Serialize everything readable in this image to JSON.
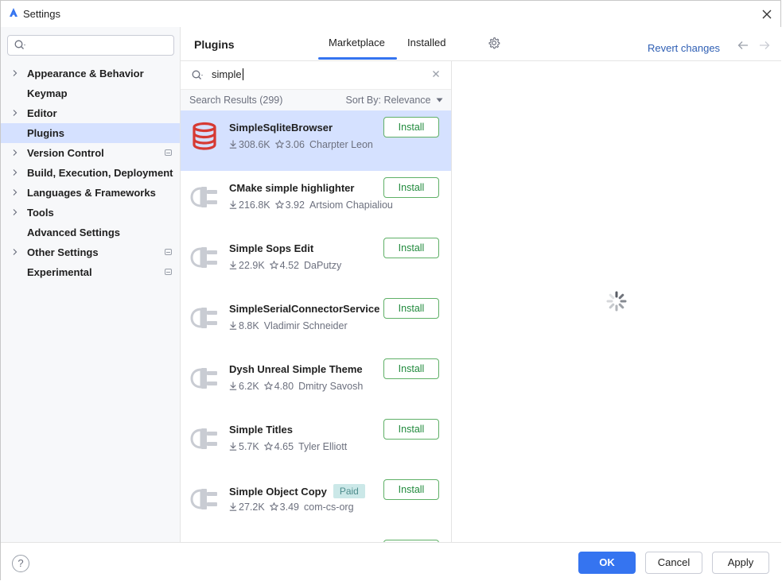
{
  "window": {
    "title": "Settings"
  },
  "sidebar": {
    "search_placeholder": "",
    "items": [
      {
        "label": "Appearance & Behavior",
        "expandable": true,
        "selected": false,
        "config": false
      },
      {
        "label": "Keymap",
        "expandable": false,
        "selected": false,
        "config": false
      },
      {
        "label": "Editor",
        "expandable": true,
        "selected": false,
        "config": false
      },
      {
        "label": "Plugins",
        "expandable": false,
        "selected": true,
        "config": false
      },
      {
        "label": "Version Control",
        "expandable": true,
        "selected": false,
        "config": true
      },
      {
        "label": "Build, Execution, Deployment",
        "expandable": true,
        "selected": false,
        "config": false
      },
      {
        "label": "Languages & Frameworks",
        "expandable": true,
        "selected": false,
        "config": false
      },
      {
        "label": "Tools",
        "expandable": true,
        "selected": false,
        "config": false
      },
      {
        "label": "Advanced Settings",
        "expandable": false,
        "selected": false,
        "config": false
      },
      {
        "label": "Other Settings",
        "expandable": true,
        "selected": false,
        "config": true
      },
      {
        "label": "Experimental",
        "expandable": false,
        "selected": false,
        "config": true
      }
    ]
  },
  "header": {
    "title": "Plugins",
    "tabs": [
      {
        "label": "Marketplace",
        "active": true
      },
      {
        "label": "Installed",
        "active": false
      }
    ],
    "revert_label": "Revert changes"
  },
  "search": {
    "value": "simple"
  },
  "results": {
    "count_label": "Search Results (299)",
    "sort_label": "Sort By: Relevance"
  },
  "plugins": [
    {
      "name": "SimpleSqliteBrowser",
      "downloads": "308.6K",
      "rating": "3.06",
      "vendor": "Charpter Leon",
      "button": "Install",
      "icon": "database-icon",
      "selected": true,
      "paid": false
    },
    {
      "name": "CMake simple highlighter",
      "downloads": "216.8K",
      "rating": "3.92",
      "vendor": "Artsiom Chapialiou",
      "button": "Install",
      "icon": "plugin-plug-icon",
      "selected": false,
      "paid": false
    },
    {
      "name": "Simple Sops Edit",
      "downloads": "22.9K",
      "rating": "4.52",
      "vendor": "DaPutzy",
      "button": "Install",
      "icon": "plugin-plug-icon",
      "selected": false,
      "paid": false
    },
    {
      "name": "SimpleSerialConnectorService",
      "downloads": "8.8K",
      "rating": "",
      "vendor": "Vladimir Schneider",
      "button": "Install",
      "icon": "plugin-plug-icon",
      "selected": false,
      "paid": false
    },
    {
      "name": "Dysh Unreal Simple Theme",
      "downloads": "6.2K",
      "rating": "4.80",
      "vendor": "Dmitry Savosh",
      "button": "Install",
      "icon": "plugin-plug-icon",
      "selected": false,
      "paid": false
    },
    {
      "name": "Simple Titles",
      "downloads": "5.7K",
      "rating": "4.65",
      "vendor": "Tyler Elliott",
      "button": "Install",
      "icon": "plugin-plug-icon",
      "selected": false,
      "paid": false
    },
    {
      "name": "Simple Object Copy",
      "downloads": "27.2K",
      "rating": "3.49",
      "vendor": "com-cs-org",
      "button": "Install",
      "icon": "plugin-plug-icon",
      "selected": false,
      "paid": true,
      "paid_label": "Paid"
    }
  ],
  "footer": {
    "help_label": "?",
    "ok_label": "OK",
    "cancel_label": "Cancel",
    "apply_label": "Apply"
  },
  "colors": {
    "accent": "#3574f0",
    "selection": "#d5e1ff",
    "install_green": "#208a3c",
    "link_blue": "#2f5fb4",
    "paid_badge_bg": "#cbe8e8",
    "database_red": "#d63a33"
  }
}
